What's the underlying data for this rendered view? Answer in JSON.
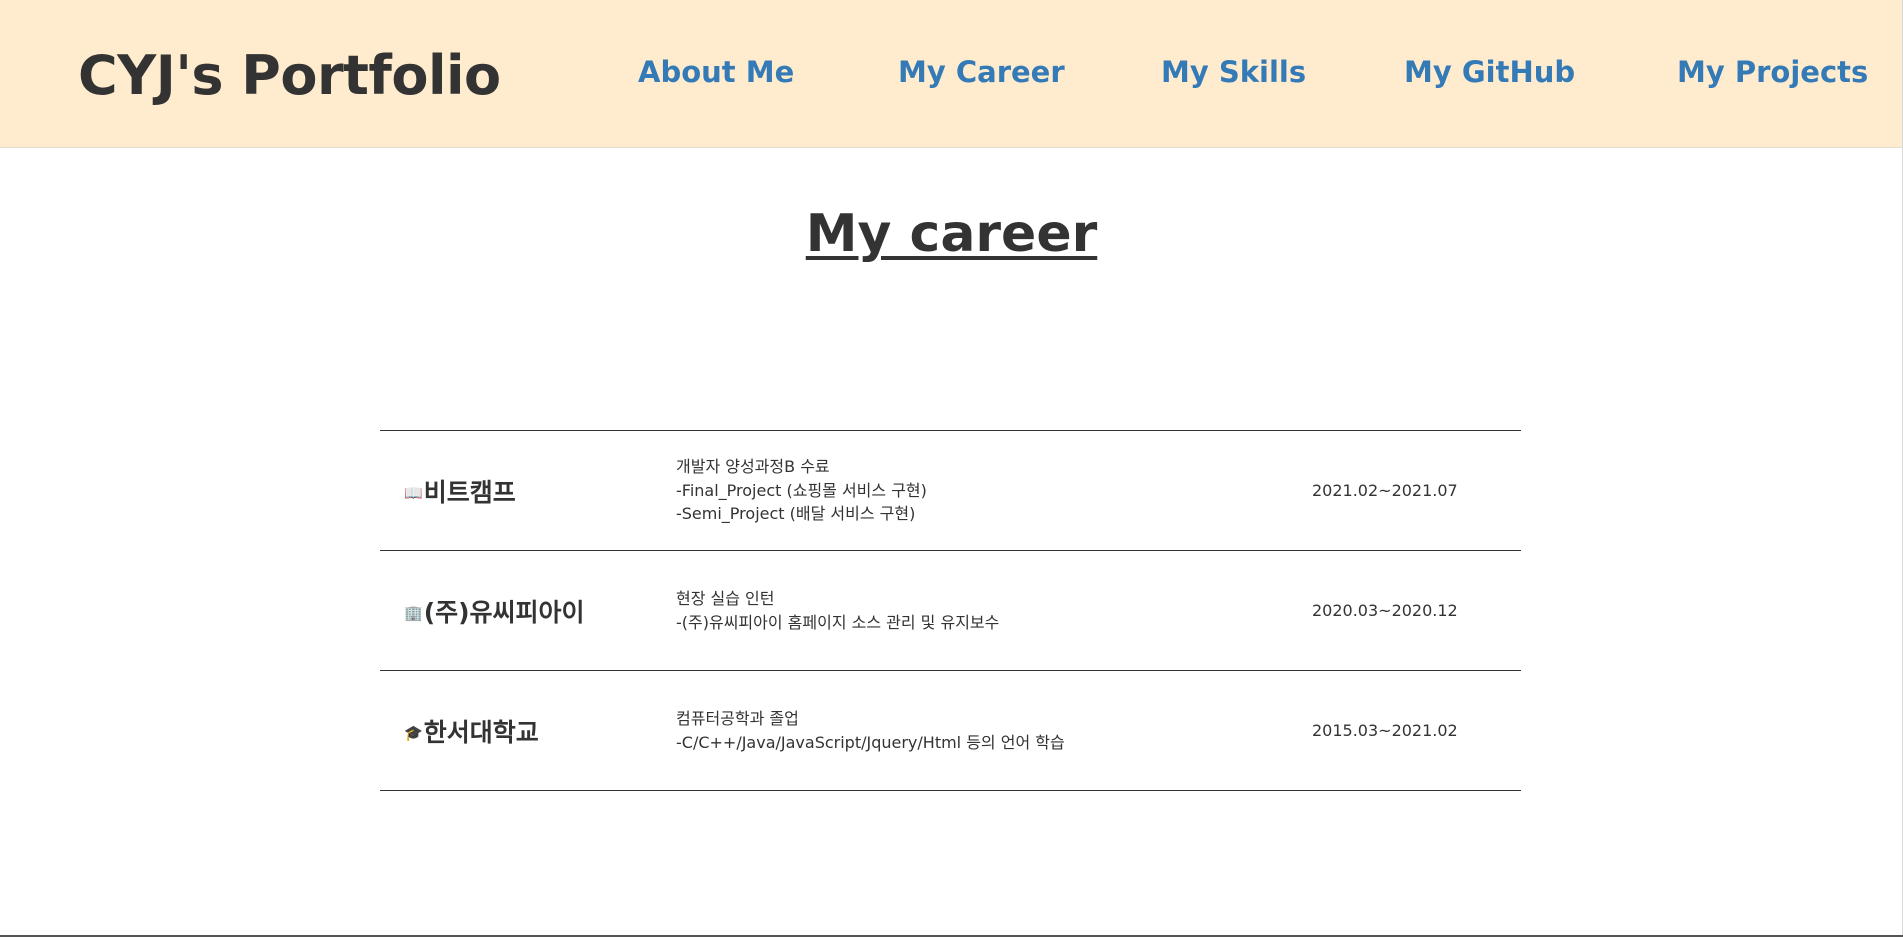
{
  "header": {
    "brand": "CYJ's Portfolio",
    "nav": [
      {
        "label": "About Me"
      },
      {
        "label": "My Career"
      },
      {
        "label": "My Skills"
      },
      {
        "label": "My GitHub"
      },
      {
        "label": "My Projects"
      }
    ]
  },
  "main": {
    "title": "My career",
    "careers": [
      {
        "icon": "📖",
        "icon_name": "book-icon",
        "org": "비트캠프",
        "lines": [
          "개발자 양성과정B 수료",
          "-Final_Project (쇼핑몰 서비스 구현)",
          "-Semi_Project (배달 서비스 구현)"
        ],
        "period": "2021.02~2021.07"
      },
      {
        "icon": "🏢",
        "icon_name": "office-building-icon",
        "org": "(주)유씨피아이",
        "lines": [
          "현장 실습 인턴",
          "-(주)유씨피아이 홈페이지 소스 관리 및 유지보수"
        ],
        "period": "2020.03~2020.12"
      },
      {
        "icon": "🎓",
        "icon_name": "graduation-cap-icon",
        "org": "한서대학교",
        "lines": [
          "컴퓨터공학과 졸업",
          "-C/C++/Java/JavaScript/Jquery/Html 등의 언어 학습"
        ],
        "period": "2015.03~2021.02"
      }
    ]
  },
  "colors": {
    "header_bg": "#ffebcd",
    "nav_link": "#337ab7",
    "text": "#333333"
  }
}
